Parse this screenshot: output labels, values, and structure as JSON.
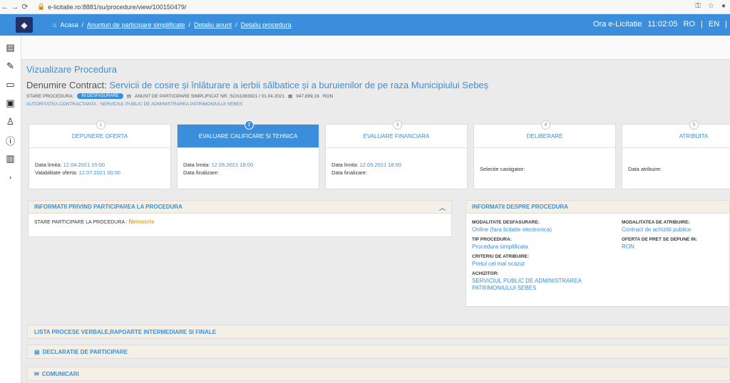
{
  "browser": {
    "back_icon": "arrow-left-icon",
    "forward_icon": "arrow-right-icon",
    "reload_icon": "reload-icon",
    "url": "e-licitatie.ro:8881/su/procedure/view/100150479/"
  },
  "topbar": {
    "logo": "SEAP-logo",
    "crumbs": [
      "Acasa",
      "Anunturi de participare simplificate",
      "Detaliu anunt",
      "Detaliu procedura"
    ],
    "clock_label": "Ora e-Licitatie",
    "clock_time": "11:02:05",
    "lang_ro": "RO",
    "lang_en": "EN",
    "lang_sep": "|"
  },
  "page": {
    "title": "Vizualizare Procedura",
    "contract_label": "Denumire Contract:",
    "contract_name": "Servicii de cosire și înlăturare a ierbii sălbatice și a buruienilor de pe raza Municipiului Sebeș",
    "stare_label": "STARE PROCEDURA:",
    "stare_badge": "IN DESFASURARE",
    "anunt": "ANUNT DE PARTICIPARE SIMPLIFICAT NR. SCN1083921 / 01.04.2021",
    "valoare": "947.899,16",
    "moneda": "RON",
    "autoritate_label": "AUTORITATEA CONTRACTANTA :",
    "autoritate": "SERVICIUL PUBLIC DE ADMINISTRAREA PATRIMONIULUI SEBES"
  },
  "steps": [
    {
      "num": "1",
      "title": "DEPUNERE OFERTA",
      "l1": "Data limita:",
      "v1": "12.04.2021 15:00",
      "l2": "Valabilitate oferta:",
      "v2": "12.07.2021 00:00"
    },
    {
      "num": "2",
      "title": "EVALUARE CALIFICARE SI TEHNICA",
      "l1": "Data limita:",
      "v1": "12.05.2021 18:00",
      "l2": "Data finalizare:",
      "v2": ""
    },
    {
      "num": "3",
      "title": "EVALUARE FINANCIARA",
      "l1": "Data limita:",
      "v1": "12.05.2021 18:00",
      "l2": "Data finalizare:",
      "v2": ""
    },
    {
      "num": "4",
      "title": "DELIBERARE",
      "l1": "Selectie castigator:",
      "v1": "",
      "l2": "",
      "v2": ""
    },
    {
      "num": "5",
      "title": "ATRIBUITA",
      "l1": "Data atribuire:",
      "v1": "",
      "l2": "",
      "v2": ""
    }
  ],
  "participare": {
    "title": "INFORMATII PRIVIND PARTICIPAREA LA PROCEDURA",
    "label": "STARE PARTICIPARE LA PROCEDURA :",
    "value": "Neinscris"
  },
  "info": {
    "title": "INFORMATII DESPRE PROCEDURA",
    "mod_label": "MODALITATE DESFASURARE:",
    "mod_value": "Online (fara licitatie electronica)",
    "tip_label": "TIP PROCEDURA:",
    "tip_value": "Procedura simplificata",
    "crit_label": "CRITERIU DE ATRIBUIRE:",
    "crit_value": "Pretul cel mai scazut",
    "achizitor_label": "ACHIZITOR:",
    "achizitor_value": "SERVICIUL PUBLIC DE ADMINISTRAREA PATRIMONIULUI SEBES",
    "modatr_label": "MODALITATEA DE ATRIBUIRE:",
    "modatr_value": "Contract de achizitii publice",
    "oferta_label": "OFERTA DE PRET SE DEPUNE IN:",
    "oferta_value": "RON"
  },
  "bars": {
    "procese": "LISTA PROCESE VERBALE,RAPOARTE INTERMEDIARE SI FINALE",
    "declaratie": "DECLARATIE DE PARTICIPARE",
    "comunicari": "COMUNICARI"
  },
  "colors": {
    "accent": "#3a8edb",
    "warning": "#e8a318"
  }
}
